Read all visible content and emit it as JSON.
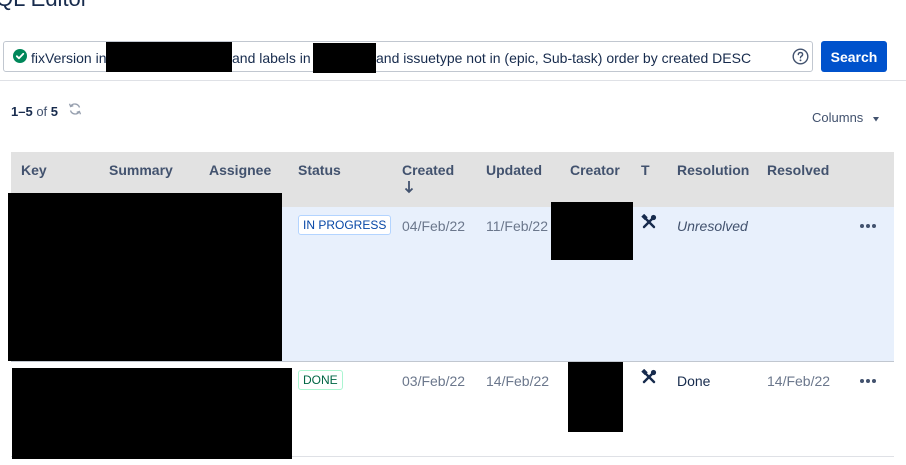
{
  "header": {
    "title": "QL Editor"
  },
  "query": {
    "parts": [
      "fixVersion in",
      "and labels in",
      "and issuetype not in (epic, Sub-task) order by created DESC"
    ],
    "valid_icon": "check-circle-icon",
    "help_icon": "question-circle-icon",
    "search_label": "Search"
  },
  "results": {
    "range": "1–5",
    "of_label": "of",
    "total": "5",
    "refresh_icon": "refresh-icon",
    "columns_label": "Columns"
  },
  "table": {
    "columns": [
      "Key",
      "Summary",
      "Assignee",
      "Status",
      "Created",
      "Updated",
      "Creator",
      "T",
      "Resolution",
      "Resolved"
    ],
    "sort_icon": "arrow-down-icon",
    "rows": [
      {
        "status": "IN PROGRESS",
        "created": "04/Feb/22",
        "updated": "11/Feb/22",
        "type_icon": "tools-icon",
        "resolution": "Unresolved",
        "resolved": ""
      },
      {
        "status": "DONE",
        "created": "03/Feb/22",
        "updated": "14/Feb/22",
        "type_icon": "tools-icon",
        "resolution": "Done",
        "resolved": "14/Feb/22"
      }
    ]
  },
  "colors": {
    "accent": "#0052cc",
    "selected_row": "#e8f0fc",
    "header_bg": "#e2e2e2",
    "success": "#00875a"
  }
}
